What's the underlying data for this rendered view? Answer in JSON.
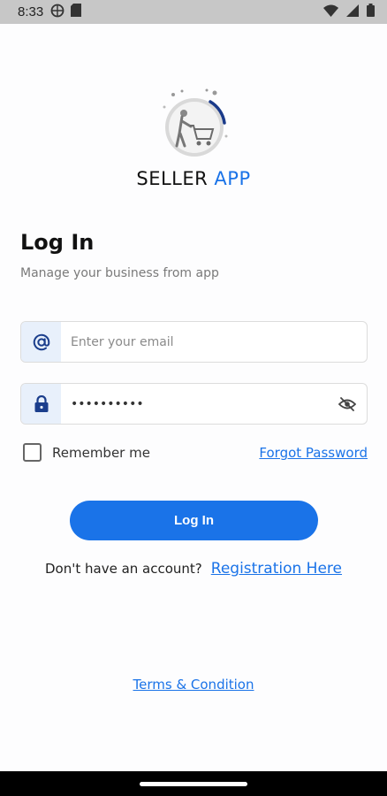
{
  "status_bar": {
    "time": "8:33",
    "icons_left": [
      "globe-icon",
      "sim-card-icon"
    ],
    "icons_right": [
      "wifi-icon",
      "signal-icon",
      "battery-icon"
    ]
  },
  "app": {
    "brand_part1": "SELLER",
    "brand_part2": "APP",
    "logo_icon": "shopping-cart-person-logo",
    "title": "Log In",
    "subtitle": "Manage your business from app",
    "email": {
      "placeholder": "Enter your email",
      "value": "",
      "icon": "at-sign-icon"
    },
    "password": {
      "value": "••••••••••",
      "icon": "lock-icon",
      "toggle_icon": "eye-off-icon"
    },
    "remember_label": "Remember me",
    "remember_checked": false,
    "forgot_label": "Forgot Password",
    "login_label": "Log In",
    "no_account_text": "Don't have an account?",
    "register_label": "Registration Here",
    "terms_label": "Terms & Condition",
    "colors": {
      "accent": "#1a73e8",
      "field_icon_bg": "#e8f0fb"
    }
  }
}
